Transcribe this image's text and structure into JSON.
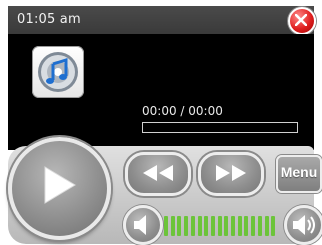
{
  "window": {
    "clock": "01:05  am"
  },
  "player": {
    "time_display": "00:00  / 00:00",
    "progress": 0,
    "volume_bars": 17,
    "volume_level": 1.0
  },
  "buttons": {
    "menu_label": "Menu"
  },
  "icons": {
    "close": "close-icon",
    "album_art": "music-note-icon",
    "play": "play-icon",
    "rewind": "rewind-icon",
    "fast_forward": "fast-forward-icon",
    "volume_down": "speaker-low-icon",
    "volume_up": "speaker-high-icon"
  },
  "colors": {
    "screen": "#000000",
    "volume_bar": "#6cc43a",
    "close_button": "#e02020",
    "button_gray": "#8e8e8e"
  }
}
